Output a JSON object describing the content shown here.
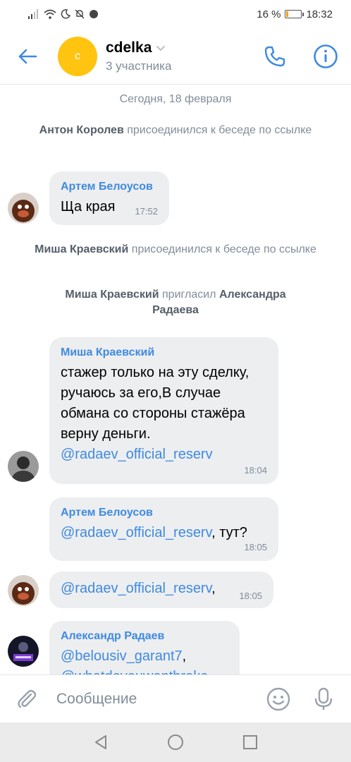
{
  "status_bar": {
    "battery_percent": "16 %",
    "battery_level": 0.16,
    "time": "18:32",
    "icons": [
      "signal-icon",
      "wifi-icon",
      "moon-icon",
      "mute-icon",
      "chat-notification-icon"
    ]
  },
  "header": {
    "avatar_letter": "c",
    "avatar_color": "#ffc410",
    "title": "cdelka",
    "subtitle": "3 участника"
  },
  "feed": {
    "date_separator": "Сегодня, 18 февраля",
    "events": [
      {
        "actor": "Антон Королев",
        "text": " присоединился к беседе по ссылке"
      },
      {
        "actor": "Миша Краевский",
        "text": " присоединился к беседе по ссылке"
      },
      {
        "actor": "Миша Краевский",
        "text": " пригласил ",
        "target": "Александра Радаева"
      }
    ],
    "messages": [
      {
        "author": "Артем Белоусов",
        "text": "Ща края",
        "time": "17:52"
      },
      {
        "author": "Миша Краевский",
        "text": "стажер только на эту сделку, ручаюсь за его,В случае обмана со стороны стажёра верну деньги. ",
        "mention": "@radaev_official_reserv",
        "time": "18:04"
      },
      {
        "author": "Артем Белоусов",
        "mention": "@radaev_official_reserv",
        "text": ", тут?",
        "time": "18:05"
      },
      {
        "mention": "@radaev_official_reserv",
        "text": ",",
        "time": "18:05"
      },
      {
        "author": "Александр Радаев",
        "mention": "@belousiv_garant7",
        "text": ",",
        "mention2": "@whatdoyouwantbroke"
      }
    ]
  },
  "composer": {
    "placeholder": "Сообщение"
  },
  "colors": {
    "accent": "#3f8ae0",
    "bubble": "#edeef0",
    "secondary_text": "#818c99"
  }
}
